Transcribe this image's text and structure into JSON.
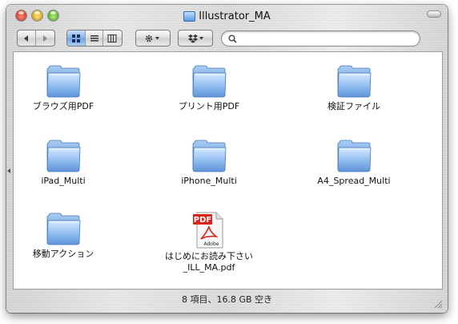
{
  "window": {
    "title": "Illustrator_MA"
  },
  "toolbar": {
    "back_icon": "back-arrow-icon",
    "forward_icon": "forward-arrow-icon",
    "view_modes": [
      "icon-view",
      "list-view",
      "column-view"
    ],
    "selected_view": "icon-view",
    "search": {
      "value": "",
      "placeholder": ""
    }
  },
  "items": [
    {
      "name": "ブラウズ用PDF",
      "kind": "folder"
    },
    {
      "name": "プリント用PDF",
      "kind": "folder"
    },
    {
      "name": "検証ファイル",
      "kind": "folder"
    },
    {
      "name": "iPad_Multi",
      "kind": "folder"
    },
    {
      "name": "iPhone_Multi",
      "kind": "folder"
    },
    {
      "name": "A4_Spread_Multi",
      "kind": "folder"
    },
    {
      "name": "移動アクション",
      "kind": "folder"
    },
    {
      "name_line1": "はじめにお読み下さい",
      "name_line2": "_ILL_MA.pdf",
      "kind": "pdf",
      "badge": "PDF",
      "brand": "Adobe"
    }
  ],
  "status": "8 項目、16.8 GB 空き",
  "colors": {
    "selected_view": "#6aa2e5",
    "folder": "#8fbcef",
    "pdf_badge": "#d8241c"
  }
}
